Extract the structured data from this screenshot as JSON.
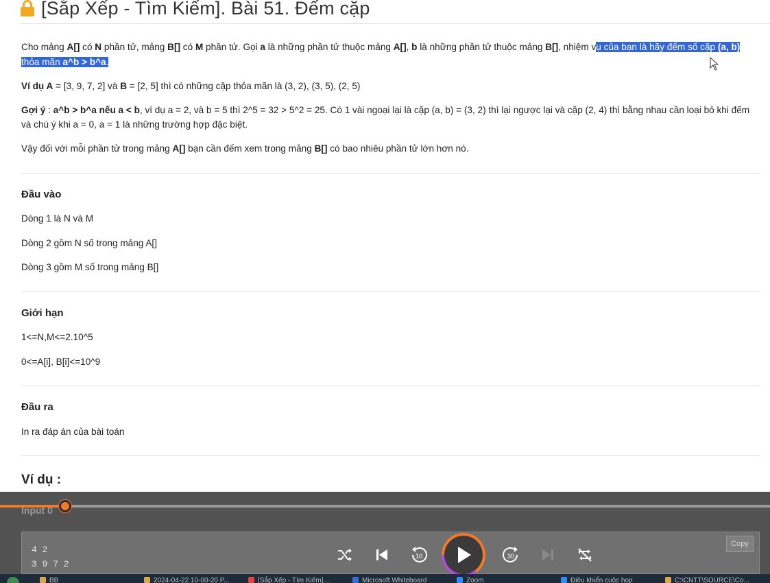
{
  "title": {
    "text": "[Sắp Xếp - Tìm Kiếm]. Bài 51. Đếm cặp",
    "icon": "lock-icon",
    "icon_color": "#f5a623"
  },
  "statement": {
    "p1": {
      "t1": "Cho mảng ",
      "b1": "A[]",
      "t2": " có ",
      "b2": "N",
      "t3": " phần tử, mảng ",
      "b3": "B[]",
      "t4": " có ",
      "b4": "M",
      "t5": " phần tử. Gọi ",
      "b5": "a",
      "t6": " là những phần tử thuộc mảng ",
      "b6": "A[]",
      "t7": ", ",
      "b7": "b",
      "t8": " là những phần tử thuộc mảng ",
      "b8": "B[]",
      "t9": ", nhiệm v",
      "h1": "ụ của bạn là hãy đếm số cặp ",
      "hb1": "(a, b)",
      "h2": " thỏa mãn ",
      "hb2": "a^b > b^a",
      "h3": "."
    },
    "p2": {
      "b1": "Ví dụ A",
      "t1": " = [3, 9, 7, 2] và ",
      "b2": "B",
      "t2": " = [2, 5] thì có những cặp thỏa mãn là (3, 2), (3, 5), (2, 5)"
    },
    "p3": {
      "b1": "Gợi ý",
      "t1": " : ",
      "b2": "a^b > b^a nếu a < b",
      "t2": ", ví dụ a = 2, và b = 5 thì 2^5 = 32 > 5^2 = 25. Có 1 vài ngoại lại là cặp (a, b) = (3, 2) thì lại ngược lại và cặp (2, 4) thì bằng nhau cần loại bỏ khi đếm và chú ý khi a = 0, a = 1 là những trường hợp đặc biệt."
    },
    "p4": {
      "t1": "Vậy đối với mỗi phần tử trong mảng ",
      "b1": "A[]",
      "t2": " bạn cần đếm xem trong mảng ",
      "b2": "B[]",
      "t3": " có bao nhiêu phần tử lớn hơn nó."
    }
  },
  "sections": {
    "input": {
      "heading": "Đầu vào",
      "lines": [
        "Dòng 1 là N và M",
        "Dòng 2 gồm N số trong mảng A[]",
        "Dòng 3 gồm M số trong mảng B[]"
      ]
    },
    "limits": {
      "heading": "Giới hạn",
      "lines": [
        "1<=N,M<=2.10^5",
        "0<=A[i], B[i]<=10^9"
      ]
    },
    "output": {
      "heading": "Đầu ra",
      "lines": [
        "In ra đáp án của bài toán"
      ]
    },
    "examples_heading": "Ví dụ :"
  },
  "video_player": {
    "input_label": "Input 0",
    "code_lines": [
      "4 2",
      "3 9 7 2"
    ],
    "copy_label": "Copy",
    "progress_fraction": 0.085,
    "accent_color": "#f07a2a",
    "controls": [
      "shuffle-icon",
      "previous-icon",
      "rewind-10-icon",
      "play-icon",
      "forward-30-icon",
      "next-icon",
      "repeat-off-icon"
    ],
    "rewind_label": "10",
    "forward_label": "30"
  },
  "taskbar": {
    "items": [
      "BB",
      "2024-04-22 10-00-20 P...",
      "[Sắp Xếp - Tìm Kiếm]...",
      "Microsoft Whiteboard",
      "Zoom",
      "Điều khiển cuộc họp",
      "C:\\CNTT\\SOURCE\\Co..."
    ]
  }
}
